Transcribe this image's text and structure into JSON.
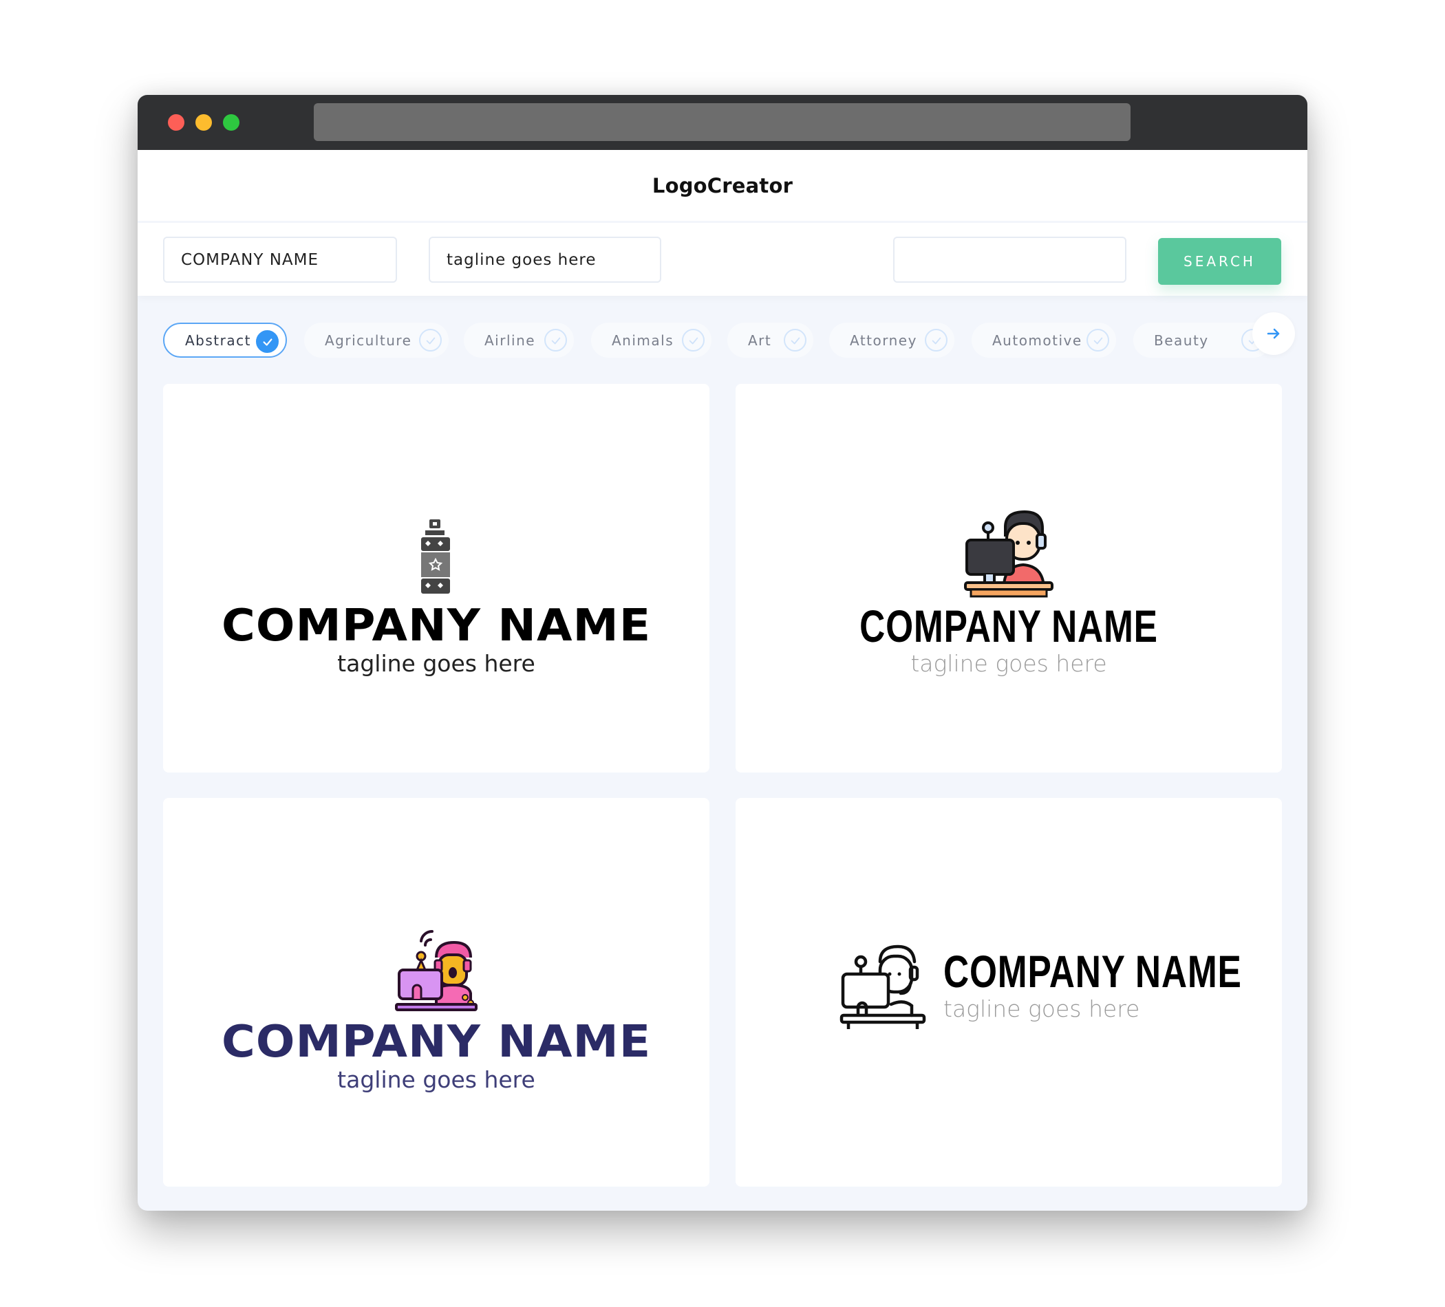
{
  "window": {
    "controls": [
      "close",
      "minimize",
      "maximize"
    ],
    "address_bar": ""
  },
  "header": {
    "brand": "LogoCreator"
  },
  "search": {
    "company_name_value": "COMPANY NAME",
    "tagline_value": "tagline goes here",
    "extra_value": "",
    "search_label": "SEARCH"
  },
  "categories": [
    {
      "label": "Abstract",
      "selected": true
    },
    {
      "label": "Agriculture",
      "selected": false
    },
    {
      "label": "Airline",
      "selected": false
    },
    {
      "label": "Animals",
      "selected": false
    },
    {
      "label": "Art",
      "selected": false
    },
    {
      "label": "Attorney",
      "selected": false
    },
    {
      "label": "Automotive",
      "selected": false
    },
    {
      "label": "Beauty",
      "selected": false
    }
  ],
  "next_icon": "arrow-right-icon",
  "colors": {
    "accent_green": "#5ac89d",
    "accent_blue": "#3396f5",
    "navy": "#2b2b66"
  },
  "logos": [
    {
      "icon": "spray-can-icon",
      "company": "COMPANY NAME",
      "tagline": "tagline goes here"
    },
    {
      "icon": "streamer-at-computer-icon",
      "company": "COMPANY NAME",
      "tagline": "tagline goes here"
    },
    {
      "icon": "podcaster-broadcasting-icon",
      "company": "COMPANY NAME",
      "tagline": "tagline goes here"
    },
    {
      "icon": "streamer-outline-icon",
      "company": "COMPANY NAME",
      "tagline": "tagline goes here"
    }
  ]
}
